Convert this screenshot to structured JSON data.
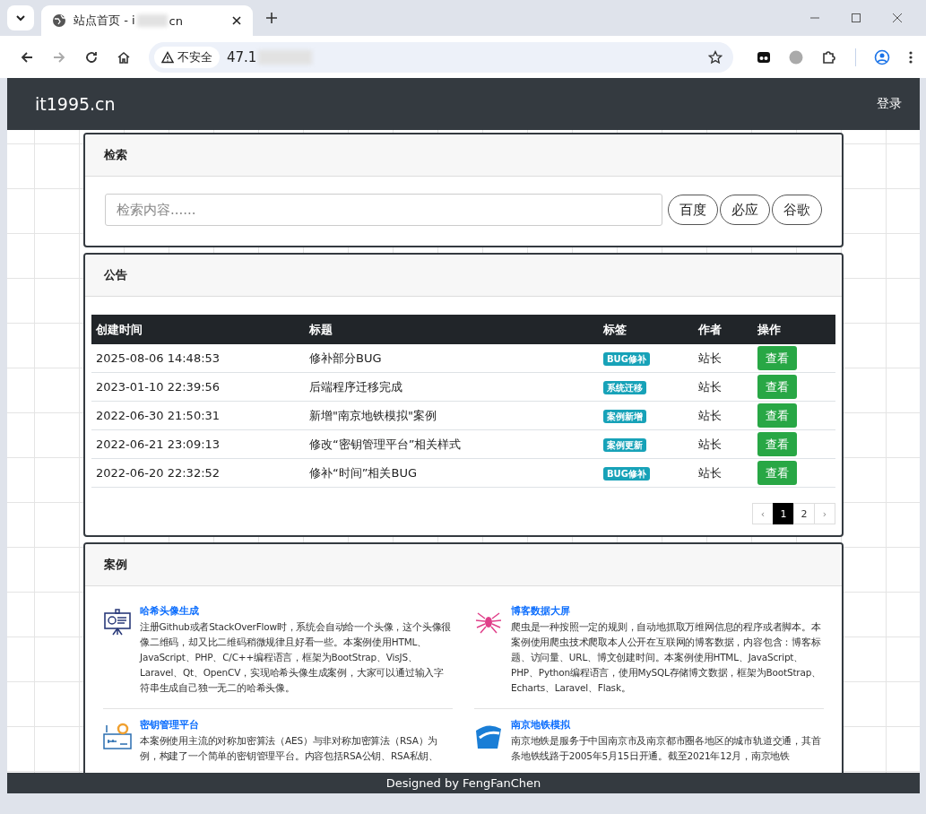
{
  "browser": {
    "tab": {
      "title_start": "站点首页 - i",
      "title_end": "cn",
      "selected": true
    },
    "address": {
      "security": "不安全",
      "url_start": "47.1"
    }
  },
  "navbar": {
    "brand": "it1995.cn",
    "login": "登录"
  },
  "search": {
    "title": "检索",
    "placeholder": "检索内容......",
    "engines": [
      "百度",
      "必应",
      "谷歌"
    ]
  },
  "notices": {
    "title": "公告",
    "columns": [
      "创建时间",
      "标题",
      "标签",
      "作者",
      "操作"
    ],
    "rows": [
      {
        "created": "2025-08-06 14:48:53",
        "title": "修补部分BUG",
        "tag": "BUG修补",
        "author": "站长",
        "action": "查看"
      },
      {
        "created": "2023-01-10 22:39:56",
        "title": "后端程序迁移完成",
        "tag": "系统迁移",
        "author": "站长",
        "action": "查看"
      },
      {
        "created": "2022-06-30 21:50:31",
        "title": "新增\"南京地铁模拟\"案例",
        "tag": "案例新增",
        "author": "站长",
        "action": "查看"
      },
      {
        "created": "2022-06-21 23:09:13",
        "title": "修改“密钥管理平台”相关样式",
        "tag": "案例更新",
        "author": "站长",
        "action": "查看"
      },
      {
        "created": "2022-06-20 22:32:52",
        "title": "修补“时间”相关BUG",
        "tag": "BUG修补",
        "author": "站长",
        "action": "查看"
      }
    ],
    "pagination": [
      {
        "label": "‹",
        "kind": "prev",
        "selected": false
      },
      {
        "label": "1",
        "kind": "page",
        "selected": true
      },
      {
        "label": "2",
        "kind": "page",
        "selected": false
      },
      {
        "label": "›",
        "kind": "next",
        "selected": false
      }
    ]
  },
  "cases": {
    "title": "案例",
    "items": [
      {
        "kind": "presentation",
        "title": "哈希头像生成",
        "description": "注册Github或者StackOverFlow时，系统会自动给一个头像，这个头像很像二维码，却又比二维码稍微规律且好看一些。本案例使用HTML、JavaScript、PHP、C/C++编程语言，框架为BootStrap、VisJS、Laravel、Qt、OpenCV，实现哈希头像生成案例，大家可以通过输入字符串生成自己独一无二的哈希头像。"
      },
      {
        "kind": "spider",
        "title": "博客数据大屏",
        "description": "爬虫是一种按照一定的规则，自动地抓取万维网信息的程序或者脚本。本案例使用爬虫技术爬取本人公开在互联网的博客数据，内容包含：博客标题、访问量、URL、博文创建时间。本案例使用HTML、JavaScript、PHP、Python编程语言，使用MySQL存储博文数据，框架为BootStrap、Echarts、Laravel、Flask。"
      },
      {
        "kind": "key",
        "title": "密钥管理平台",
        "description": "本案例使用主流的对称加密算法（AES）与非对称加密算法（RSA）为例，构建了一个简单的密钥管理平台。内容包括RSA公钥、RSA私钥、"
      },
      {
        "kind": "train",
        "title": "南京地铁模拟",
        "description": "南京地铁是服务于中国南京市及南京都市圈各地区的城市轨道交通，其首条地铁线路于2005年5月15日开通。截至2021年12月，南京地铁"
      }
    ]
  },
  "footer": "Designed by FengFanChen"
}
